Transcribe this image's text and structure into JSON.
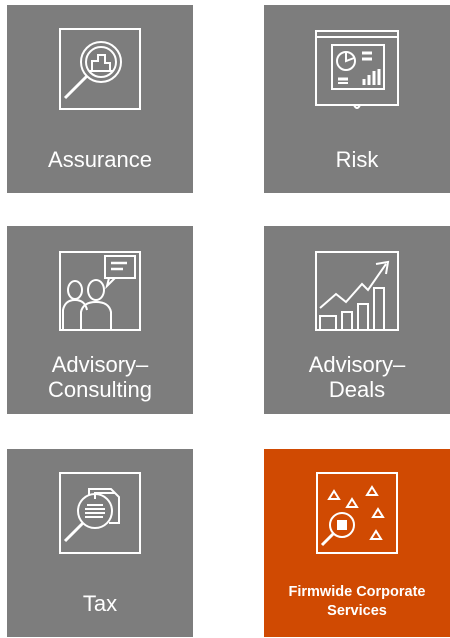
{
  "colors": {
    "tile": "#7d7d7d",
    "accent": "#d04a02",
    "text": "#ffffff"
  },
  "tiles": [
    {
      "label": "Assurance",
      "icon": "magnifier-bar-chart-icon"
    },
    {
      "label": "Risk",
      "icon": "presentation-board-icon"
    },
    {
      "label_lines": [
        "Advisory–",
        "Consulting"
      ],
      "icon": "people-speech-bubble-icon"
    },
    {
      "label_lines": [
        "Advisory–",
        "Deals"
      ],
      "icon": "growth-chart-icon"
    },
    {
      "label": "Tax",
      "icon": "magnifier-documents-icon"
    },
    {
      "label_lines": [
        "Firmwide Corporate",
        "Services"
      ],
      "icon": "triangles-magnifier-icon"
    }
  ]
}
